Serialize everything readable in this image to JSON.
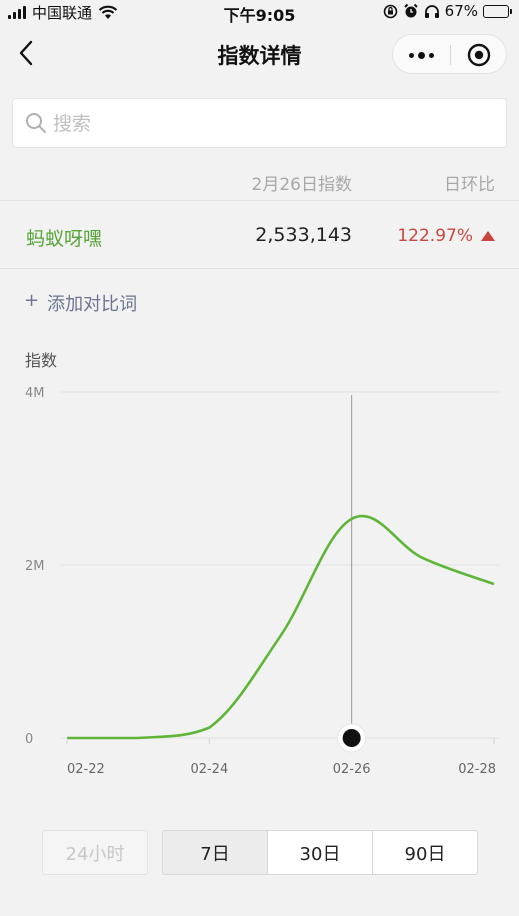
{
  "status_bar": {
    "carrier": "中国联通",
    "time": "下午9:05",
    "battery": "67%",
    "battery_level": 0.67,
    "icons": [
      "signal-icon",
      "wifi-icon",
      "rotation-lock-icon",
      "alarm-icon",
      "headphones-icon",
      "battery-icon"
    ]
  },
  "nav": {
    "title": "指数详情",
    "icons": [
      "back-icon",
      "more-icon",
      "close-icon"
    ]
  },
  "search": {
    "placeholder": "搜索",
    "value": ""
  },
  "table": {
    "date_header": "2月26日指数",
    "ratio_header": "日环比",
    "row": {
      "name": "蚂蚁呀嘿",
      "value": "2,533,143",
      "ratio": "122.97%",
      "trend": "up"
    }
  },
  "add_compare": {
    "plus": "+",
    "label": "添加对比词"
  },
  "colors": {
    "accent": "#57a437",
    "increase": "#c9463f",
    "link": "#6a7590"
  },
  "chart_data": {
    "type": "line",
    "ylabel": "指数",
    "yticks": [
      {
        "value": 0,
        "label": "0"
      },
      {
        "value": 2000000,
        "label": "2M"
      },
      {
        "value": 4000000,
        "label": "4M"
      }
    ],
    "ylim": [
      0,
      4000000
    ],
    "xticks": [
      "02-22",
      "02-24",
      "02-26",
      "02-28"
    ],
    "x": [
      "02-22",
      "02-23",
      "02-24",
      "02-25",
      "02-26",
      "02-27",
      "02-28"
    ],
    "values": [
      0,
      0,
      120000,
      1180000,
      2533143,
      2080000,
      1780000
    ],
    "selected_index": 4,
    "grid": true,
    "line_color": "#5fb53a"
  },
  "range_tabs": [
    {
      "label": "24小时",
      "state": "disabled"
    },
    {
      "label": "7日",
      "state": "selected"
    },
    {
      "label": "30日",
      "state": "normal"
    },
    {
      "label": "90日",
      "state": "normal"
    }
  ]
}
